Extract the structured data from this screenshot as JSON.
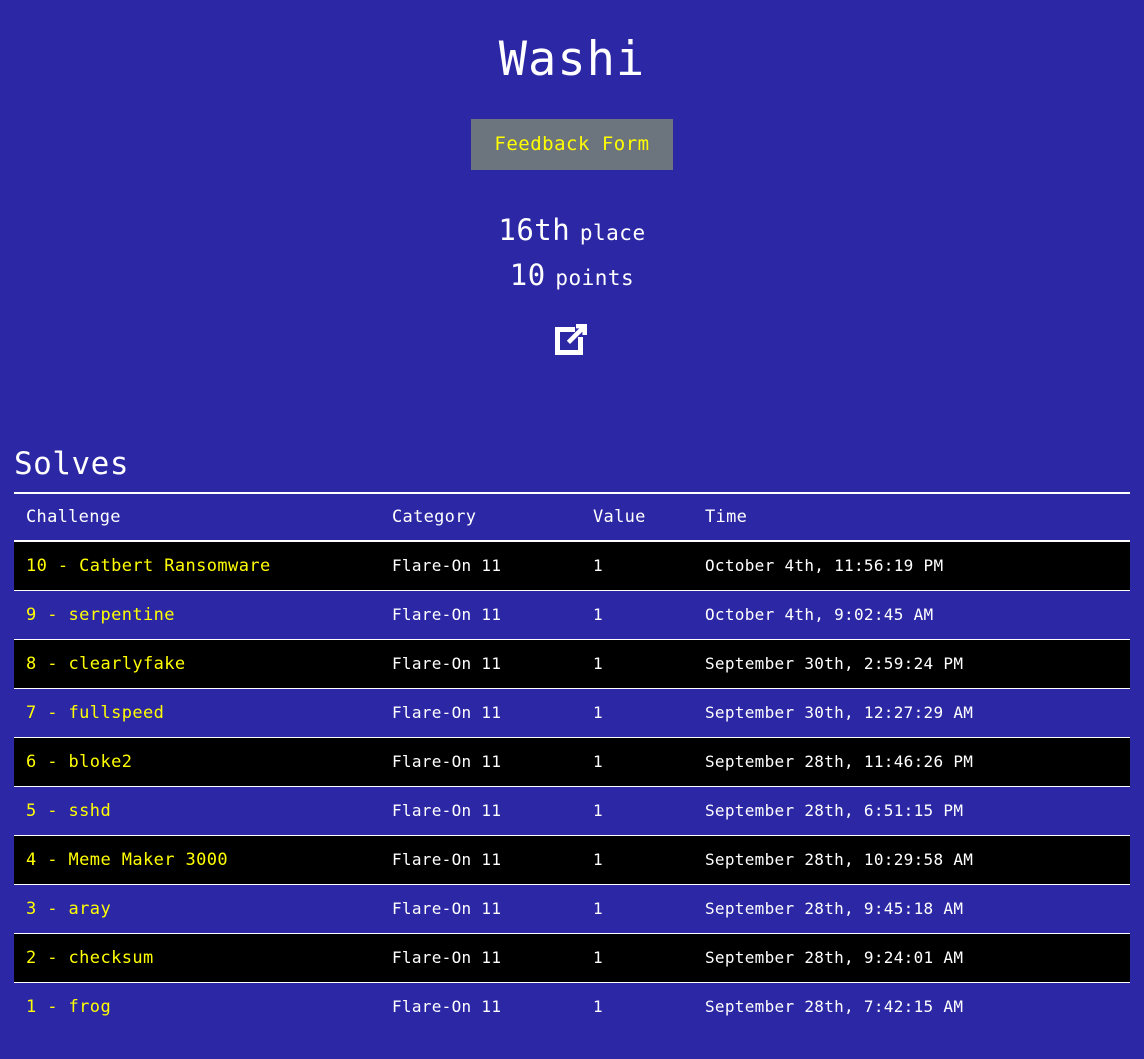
{
  "header": {
    "title": "Washi",
    "feedback_label": "Feedback Form"
  },
  "stats": {
    "place_number": "16th",
    "place_word": "place",
    "points_number": "10",
    "points_word": "points",
    "external_link_icon": "external-link-icon"
  },
  "solves": {
    "heading": "Solves",
    "columns": {
      "challenge": "Challenge",
      "category": "Category",
      "value": "Value",
      "time": "Time"
    },
    "rows": [
      {
        "challenge": "10 - Catbert Ransomware",
        "category": "Flare-On 11",
        "value": "1",
        "time": "October 4th, 11:56:19 PM"
      },
      {
        "challenge": "9 - serpentine",
        "category": "Flare-On 11",
        "value": "1",
        "time": "October 4th, 9:02:45 AM"
      },
      {
        "challenge": "8 - clearlyfake",
        "category": "Flare-On 11",
        "value": "1",
        "time": "September 30th, 2:59:24 PM"
      },
      {
        "challenge": "7 - fullspeed",
        "category": "Flare-On 11",
        "value": "1",
        "time": "September 30th, 12:27:29 AM"
      },
      {
        "challenge": "6 - bloke2",
        "category": "Flare-On 11",
        "value": "1",
        "time": "September 28th, 11:46:26 PM"
      },
      {
        "challenge": "5 - sshd",
        "category": "Flare-On 11",
        "value": "1",
        "time": "September 28th, 6:51:15 PM"
      },
      {
        "challenge": "4 - Meme Maker 3000",
        "category": "Flare-On 11",
        "value": "1",
        "time": "September 28th, 10:29:58 AM"
      },
      {
        "challenge": "3 - aray",
        "category": "Flare-On 11",
        "value": "1",
        "time": "September 28th, 9:45:18 AM"
      },
      {
        "challenge": "2 - checksum",
        "category": "Flare-On 11",
        "value": "1",
        "time": "September 28th, 9:24:01 AM"
      },
      {
        "challenge": "1 - frog",
        "category": "Flare-On 11",
        "value": "1",
        "time": "September 28th, 7:42:15 AM"
      }
    ]
  },
  "colors": {
    "background": "#2b27a5",
    "accent_yellow": "#ffff00",
    "button_gray": "#6c757d",
    "row_dark": "#000000",
    "text_white": "#ffffff"
  }
}
